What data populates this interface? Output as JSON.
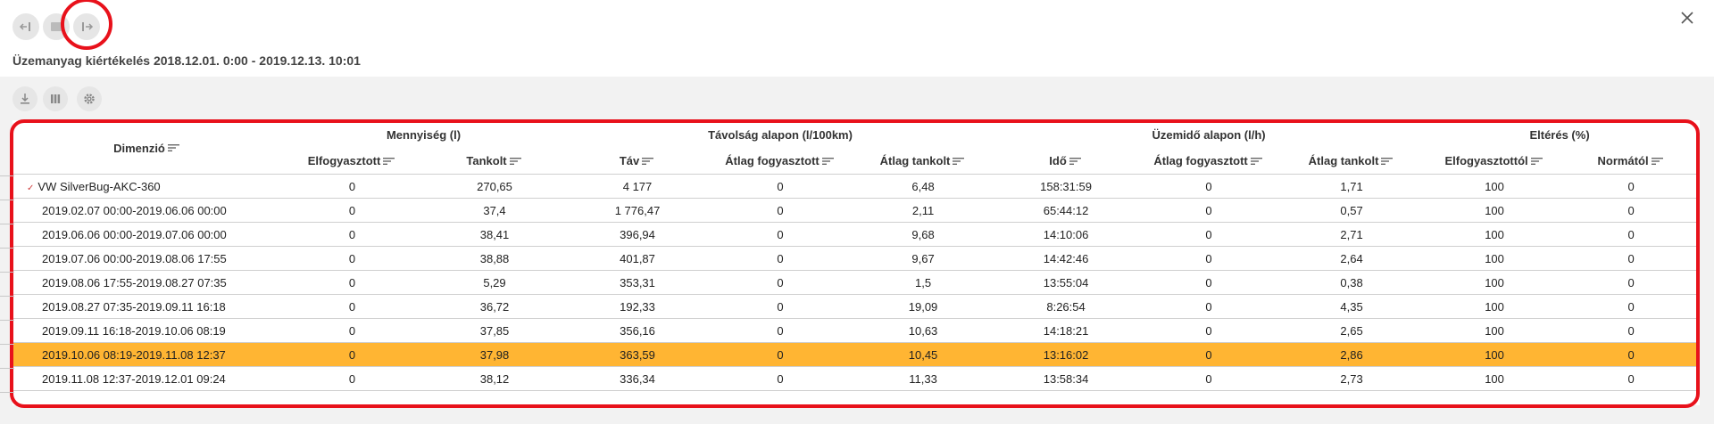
{
  "nav": {
    "back_icon": "arrow-left-bar-icon",
    "middle_icon": "columns-icon",
    "forward_icon": "arrow-right-bar-icon",
    "close_icon": "close-icon"
  },
  "title": "Üzemanyag kiértékelés 2018.12.01. 0:00 - 2019.12.13. 10:01",
  "toolbar": {
    "download_icon": "download-icon",
    "columns_icon": "columns-icon",
    "settings_icon": "gear-icon"
  },
  "colors": {
    "highlight": "#e8111b",
    "selected_row": "#ffb533",
    "button_bg": "#e6e6e6"
  },
  "table": {
    "dimension_header": "Dimenzió",
    "groups": [
      {
        "label": "Mennyiség (l)"
      },
      {
        "label": "Távolság alapon (l/100km)"
      },
      {
        "label": "Üzemidő alapon (l/h)"
      },
      {
        "label": "Eltérés (%)"
      }
    ],
    "columns": [
      "Elfogyasztott",
      "Tankolt",
      "Táv",
      "Átlag fogyasztott",
      "Átlag tankolt",
      "Idő",
      "Átlag fogyasztott",
      "Átlag tankolt",
      "Elfogyasztottól",
      "Normától"
    ],
    "rows": [
      {
        "dim": "VW SilverBug-AKC-360",
        "cells": [
          "0",
          "270,65",
          "4 177",
          "0",
          "6,48",
          "158:31:59",
          "0",
          "1,71",
          "100",
          "0"
        ]
      },
      {
        "dim": "2019.02.07 00:00-2019.06.06 00:00",
        "cells": [
          "0",
          "37,4",
          "1 776,47",
          "0",
          "2,11",
          "65:44:12",
          "0",
          "0,57",
          "100",
          "0"
        ]
      },
      {
        "dim": "2019.06.06 00:00-2019.07.06 00:00",
        "cells": [
          "0",
          "38,41",
          "396,94",
          "0",
          "9,68",
          "14:10:06",
          "0",
          "2,71",
          "100",
          "0"
        ]
      },
      {
        "dim": "2019.07.06 00:00-2019.08.06 17:55",
        "cells": [
          "0",
          "38,88",
          "401,87",
          "0",
          "9,67",
          "14:42:46",
          "0",
          "2,64",
          "100",
          "0"
        ]
      },
      {
        "dim": "2019.08.06 17:55-2019.08.27 07:35",
        "cells": [
          "0",
          "5,29",
          "353,31",
          "0",
          "1,5",
          "13:55:04",
          "0",
          "0,38",
          "100",
          "0"
        ]
      },
      {
        "dim": "2019.08.27 07:35-2019.09.11 16:18",
        "cells": [
          "0",
          "36,72",
          "192,33",
          "0",
          "19,09",
          "8:26:54",
          "0",
          "4,35",
          "100",
          "0"
        ]
      },
      {
        "dim": "2019.09.11 16:18-2019.10.06 08:19",
        "cells": [
          "0",
          "37,85",
          "356,16",
          "0",
          "10,63",
          "14:18:21",
          "0",
          "2,65",
          "100",
          "0"
        ]
      },
      {
        "dim": "2019.10.06 08:19-2019.11.08 12:37",
        "cells": [
          "0",
          "37,98",
          "363,59",
          "0",
          "10,45",
          "13:16:02",
          "0",
          "2,86",
          "100",
          "0"
        ]
      },
      {
        "dim": "2019.11.08 12:37-2019.12.01 09:24",
        "cells": [
          "0",
          "38,12",
          "336,34",
          "0",
          "11,33",
          "13:58:34",
          "0",
          "2,73",
          "100",
          "0"
        ]
      }
    ]
  }
}
